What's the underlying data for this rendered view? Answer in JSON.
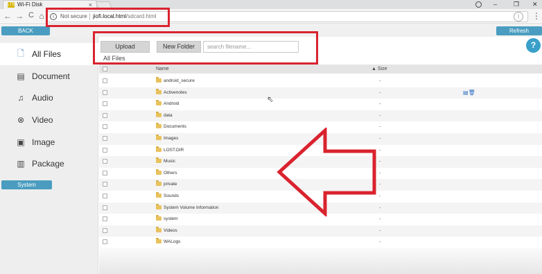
{
  "browser": {
    "tab_title": "Wi-Fi Disk",
    "tab_favicon": "LTE",
    "tab_close": "×",
    "security_label": "Not secure",
    "url_host": "jiofi.local.html",
    "url_path": "/sdcard.html",
    "back_glyph": "←",
    "forward_glyph": "→",
    "reload_glyph": "C",
    "home_glyph": "⌂",
    "menu_glyph": "⋮",
    "win_minimize": "–",
    "win_maximize": "❐",
    "win_close": "✕"
  },
  "header": {
    "back_label": "BACK",
    "refresh_label": "Refresh"
  },
  "sidebar": {
    "items": [
      {
        "label": "All Files",
        "icon": "file-icon",
        "glyph": "🗋",
        "active": true
      },
      {
        "label": "Document",
        "icon": "document-icon",
        "glyph": "▤"
      },
      {
        "label": "Audio",
        "icon": "music-icon",
        "glyph": "♫"
      },
      {
        "label": "Video",
        "icon": "video-icon",
        "glyph": "⊗"
      },
      {
        "label": "Image",
        "icon": "image-icon",
        "glyph": "▣"
      },
      {
        "label": "Package",
        "icon": "package-icon",
        "glyph": "▥"
      }
    ],
    "system_label": "System"
  },
  "toolbar": {
    "upload_label": "Upload",
    "new_folder_label": "New Folder",
    "search_placeholder": "search filename...",
    "breadcrumb": "All Files",
    "help_label": "?"
  },
  "table": {
    "col_name": "Name",
    "col_size": "▲ Size",
    "rows": [
      {
        "name": "android_secure",
        "size": "-"
      },
      {
        "name": "Activenotes",
        "size": "-",
        "actions": "▤🗑"
      },
      {
        "name": "Android",
        "size": "-"
      },
      {
        "name": "data",
        "size": "-"
      },
      {
        "name": "Documents",
        "size": "-"
      },
      {
        "name": "Images",
        "size": "-"
      },
      {
        "name": "LOST.DIR",
        "size": "-"
      },
      {
        "name": "Music",
        "size": "-"
      },
      {
        "name": "Others",
        "size": "-"
      },
      {
        "name": "private",
        "size": "-"
      },
      {
        "name": "Sounds",
        "size": "-"
      },
      {
        "name": "System Volume Information",
        "size": "-"
      },
      {
        "name": "system",
        "size": "-"
      },
      {
        "name": "Videos",
        "size": "-"
      },
      {
        "name": "WALogs",
        "size": "-"
      }
    ]
  },
  "colors": {
    "accent": "#4a9dc0",
    "annotation_red": "#d9232e"
  }
}
